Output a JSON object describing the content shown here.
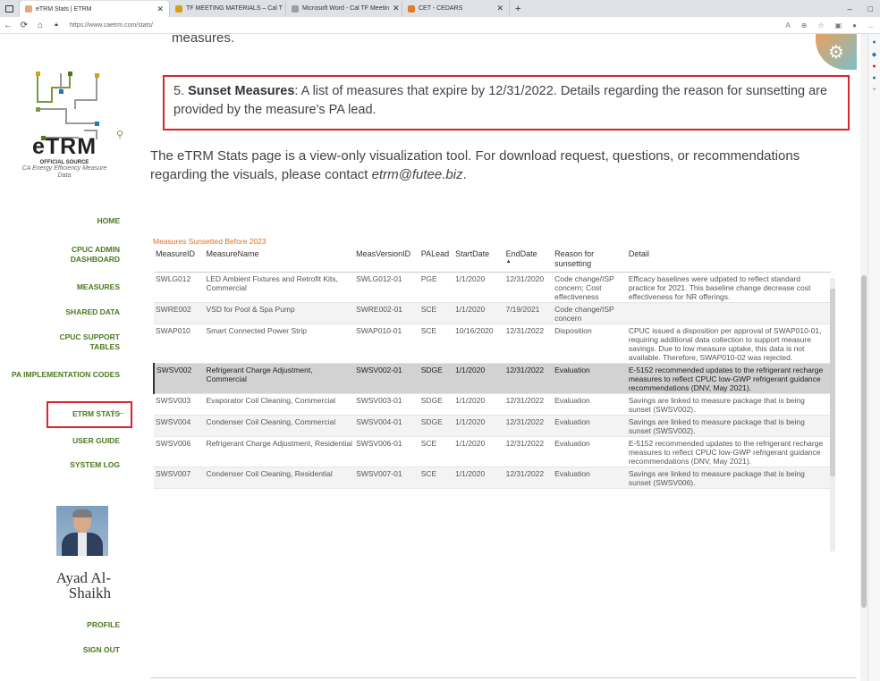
{
  "browser": {
    "tabs": [
      {
        "title": "eTRM Stats | ETRM",
        "active": true,
        "color": "#e9a77a"
      },
      {
        "title": "TF MEETING MATERIALS – Cal T",
        "active": false,
        "color": "#d4a017"
      },
      {
        "title": "Microsoft Word - Cal TF Meetin",
        "active": false,
        "color": "#9aa0a6"
      },
      {
        "title": "CET - CEDARS",
        "active": false,
        "color": "#e07b2e"
      }
    ],
    "new_tab": "+",
    "url": "https://www.caetrm.com/stats/"
  },
  "sidebar": {
    "brand": "eTRM",
    "sub1": "OFFICIAL SOURCE",
    "sub2": "CA Energy Efficiency Measure Data",
    "nav": [
      {
        "label": "HOME"
      },
      {
        "label": "CPUC ADMIN DASHBOARD"
      },
      {
        "label": "MEASURES"
      },
      {
        "label": "SHARED DATA"
      },
      {
        "label": "CPUC SUPPORT TABLES"
      },
      {
        "label": "PA IMPLEMENTATION CODES"
      },
      {
        "label": "ETRM STATS"
      },
      {
        "label": "USER GUIDE"
      },
      {
        "label": "SYSTEM LOG"
      }
    ],
    "user_name": "Ayad Al-Shaikh",
    "profile": "PROFILE",
    "sign_out": "SIGN OUT"
  },
  "main": {
    "top_cut": "measures.",
    "item_num": "5.",
    "item_title": "Sunset Measures",
    "item_text": ": A list of measures that expire by 12/31/2022. Details regarding the reason for sunsetting are provided by the measure's PA lead.",
    "intro_text": "The eTRM Stats page is a view-only visualization tool. For download request, questions, or recommendations regarding the visuals, please contact ",
    "intro_email": "etrm@futee.biz",
    "intro_end": "."
  },
  "table": {
    "title": "Measures Sunsetted Before 2023",
    "columns": [
      "MeasureID",
      "MeasureName",
      "MeasVersionID",
      "PALead",
      "StartDate",
      "EndDate",
      "Reason for sunsetting",
      "Detail"
    ],
    "sort_indicator": "▲",
    "rows": [
      [
        "SWLG012",
        "LED Ambient Fixtures and Retrofit Kits, Commercial",
        "SWLG012-01",
        "PGE",
        "1/1/2020",
        "12/31/2020",
        "Code change/ISP concern; Cost effectiveness",
        "Efficacy baselines were udpated to reflect standard practice for 2021. This baseline change decrease cost effectiveness for NR offerings."
      ],
      [
        "SWRE002",
        "VSD for Pool & Spa Pump",
        "SWRE002-01",
        "SCE",
        "1/1/2020",
        "7/19/2021",
        "Code change/ISP concern",
        ""
      ],
      [
        "SWAP010",
        "Smart Connected Power Strip",
        "SWAP010-01",
        "SCE",
        "10/16/2020",
        "12/31/2022",
        "Disposition",
        "CPUC issued a disposition per approval of SWAP010-01, requiring additional data collection to support measure savings. Due to low measure uptake, this data is not available. Therefore, SWAP010-02 was rejected."
      ],
      [
        "SWSV002",
        "Refrigerant Charge Adjustment, Commercial",
        "SWSV002-01",
        "SDGE",
        "1/1/2020",
        "12/31/2022",
        "Evaluation",
        "E-5152 recommended updates to the refrigerant recharge measures to reflect CPUC low-GWP refrigerant guidance recommendations (DNV, May 2021)."
      ],
      [
        "SWSV003",
        "Evaporator Coil Cleaning, Commercial",
        "SWSV003-01",
        "SDGE",
        "1/1/2020",
        "12/31/2022",
        "Evaluation",
        "Savings are linked to measure package that is being sunset (SWSV002)."
      ],
      [
        "SWSV004",
        "Condenser Coil Cleaning, Commercial",
        "SWSV004-01",
        "SDGE",
        "1/1/2020",
        "12/31/2022",
        "Evaluation",
        "Savings are linked to measure package that is being sunset (SWSV002)."
      ],
      [
        "SWSV006",
        "Refrigerant Charge Adjustment, Residential",
        "SWSV006-01",
        "SCE",
        "1/1/2020",
        "12/31/2022",
        "Evaluation",
        "E-5152 recommended updates to the refrigerant recharge measures to reflect CPUC low-GWP refrigerant guidance recommendations (DNV, May 2021)."
      ],
      [
        "SWSV007",
        "Condenser Coil Cleaning, Residential",
        "SWSV007-01",
        "SCE",
        "1/1/2020",
        "12/31/2022",
        "Evaluation",
        "Savings are linked to measure package that is being sunset (SWSV006)."
      ]
    ]
  },
  "colors": {
    "accent_green": "#4a7a1e",
    "highlight_red": "#d9242b",
    "table_title_orange": "#e07020"
  }
}
